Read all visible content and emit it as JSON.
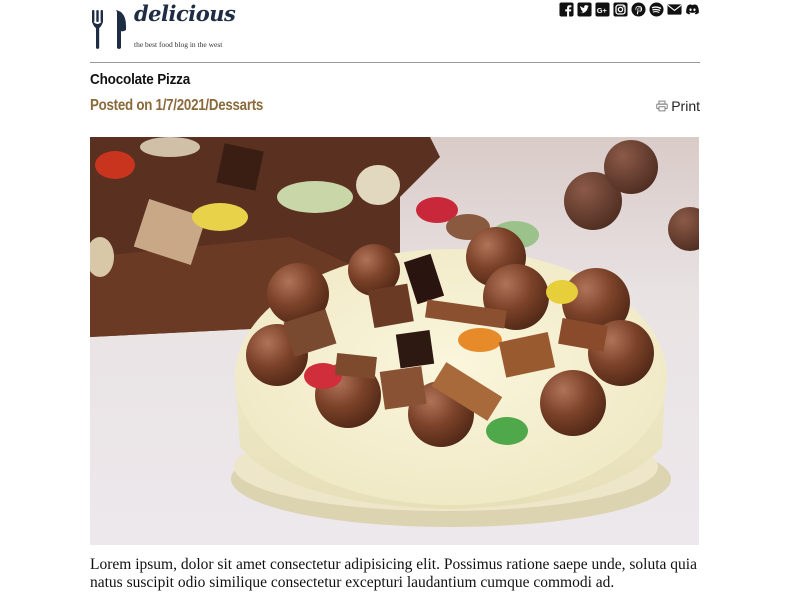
{
  "site": {
    "name": "delicious",
    "tagline": "the best food blog in the west"
  },
  "social_icons": [
    "facebook-icon",
    "twitter-icon",
    "google-plus-icon",
    "instagram-icon",
    "pinterest-icon",
    "spotify-icon",
    "email-icon",
    "discord-icon"
  ],
  "post": {
    "title": "Chocolate Pizza",
    "meta": "Posted on 1/7/2021/Dessarts",
    "print_label": "Print",
    "image_alt": "",
    "body": "Lorem ipsum, dolor sit amet consectetur adipisicing elit. Possimus ratione saepe unde, soluta quia natus suscipit odio similique consectetur excepturi laudantium cumque commodi ad."
  },
  "colors": {
    "brand_navy": "#1f2d44",
    "meta_brown": "#8a6a3a",
    "divider": "#9a9a9a"
  }
}
